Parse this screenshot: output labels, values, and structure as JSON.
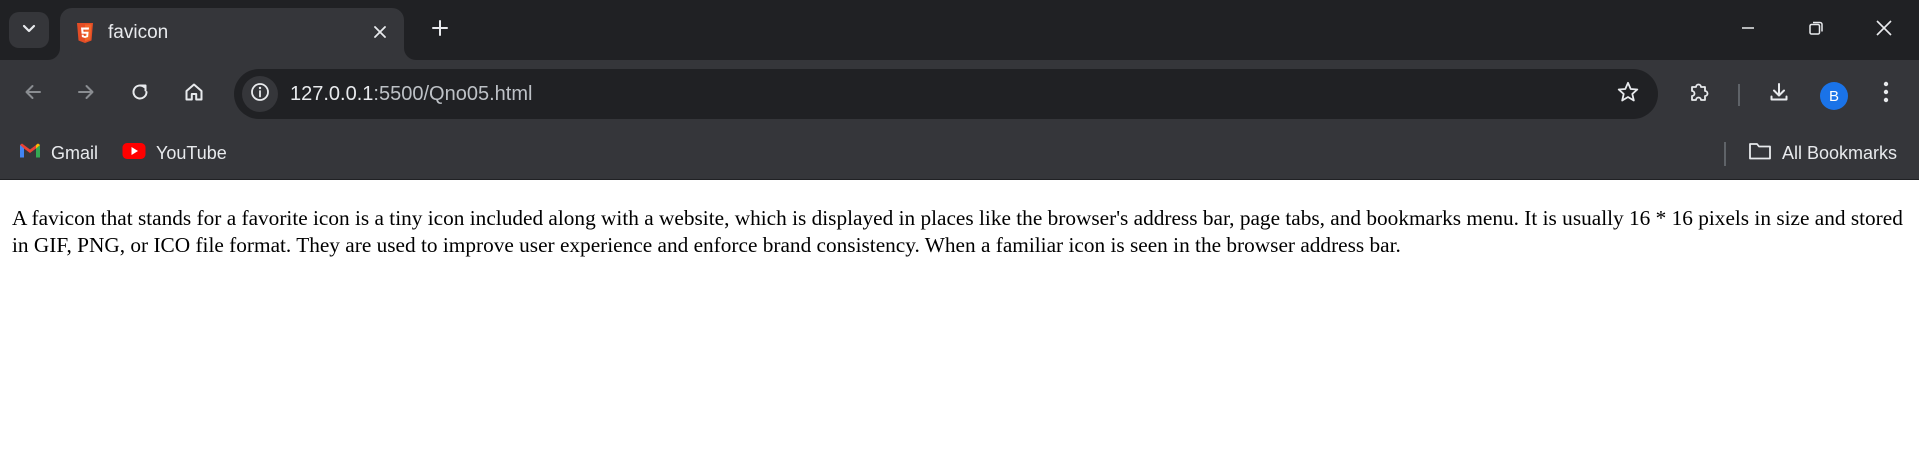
{
  "browser": {
    "tab": {
      "title": "favicon",
      "favicon": "html5-icon"
    },
    "icons": {
      "tab_search": "chevron-down-icon",
      "tab_close": "close-icon",
      "new_tab": "plus-icon",
      "minimize": "minimize-icon",
      "restore": "restore-icon",
      "close_window": "close-icon",
      "back": "arrow-left-icon",
      "forward": "arrow-right-icon",
      "reload": "reload-icon",
      "home": "home-icon",
      "site_info": "info-icon",
      "bookmark_star": "star-icon",
      "extensions": "puzzle-icon",
      "downloads": "download-icon",
      "menu": "kebab-menu-icon",
      "folder": "folder-icon"
    },
    "address_bar": {
      "host": "127.0.0.1",
      "rest": ":5500/Qno05.html"
    },
    "profile_initial": "B",
    "bookmarks": [
      {
        "label": "Gmail",
        "icon": "gmail-icon"
      },
      {
        "label": "YouTube",
        "icon": "youtube-icon"
      }
    ],
    "all_bookmarks_label": "All Bookmarks"
  },
  "page": {
    "paragraph": "A favicon that stands for a favorite icon is a tiny icon included along with a website, which is displayed in places like the browser's address bar, page tabs, and bookmarks menu. It is usually 16 * 16 pixels in size and stored in GIF, PNG, or ICO file format. They are used to improve user experience and enforce brand consistency. When a familiar icon is seen in the browser address bar."
  },
  "colors": {
    "tabstrip_bg": "#202124",
    "toolbar_bg": "#35363a",
    "omnibox_bg": "#202124",
    "text_light": "#e8eaed",
    "profile_bg": "#1a73e8",
    "html5_orange": "#e44d26"
  }
}
